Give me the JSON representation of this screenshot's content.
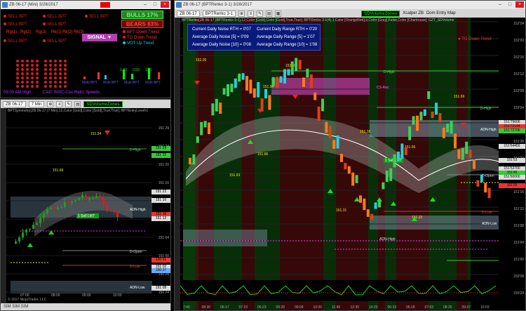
{
  "analyzer_window": {
    "title": "ZB 06-17 (Mini) 3/28/2017",
    "bulls": "BULLS 17%",
    "bears": "BEARS 83%",
    "signal": "SIGNAL",
    "signals_row1": [
      "SELL BPT",
      "SELL BPT",
      "SELL BPT"
    ],
    "signals_row2": [
      "SELL BPT",
      "SELL BPT"
    ],
    "signals_row3": [
      "SELL BPT",
      "SELL BPT"
    ],
    "rg_labels": [
      "Rg(1)",
      "Rg(2)",
      "Rg(3)",
      "Rk(1)",
      "Rk(2)",
      "Rk(3)"
    ],
    "trends": [
      "BPT Down Trend",
      "TG Down Trend",
      "VOT Up Trend"
    ],
    "dot_grid_colors": [
      "#ff3030",
      "#00c0ff"
    ],
    "bar_values": [
      "1.33",
      "0.52",
      "2.71"
    ],
    "bar_labels": [
      "Multi BPT",
      "Multi BPT",
      "Multi BPT",
      "Multi BPT"
    ],
    "footer_left": "09:00 AM   High",
    "footer_mid": "CAD: INSC-Cov-Retrc Speeds"
  },
  "left_chart": {
    "title": "ZB 06-17 (Mini) 3/28/2017",
    "instrument": "ZB 06-17",
    "interval": "7 Min",
    "indicator_tag": "SDVolumeZones",
    "header_text": "BPTSymmetry(ZB 06-17 (7 Min),12,Color [Gold],Color [Gold],True,True); BPTEntryLevelV2(ZB...",
    "labels": {
      "d_high": "D-High",
      "adn_high": "ADN-High",
      "d_open": "D-Open",
      "d_low": "D-Low",
      "adn_low": "ADN-Low",
      "price_a": "151.69",
      "price_b": "151.94",
      "price_c": "151.75",
      "price_d": "151.78",
      "sell_lmt": "1 Sell LMT"
    },
    "axis_ticks": [
      "151 29",
      "151 24",
      "151 20",
      "151 16",
      "151 12",
      "151 08",
      "151 04",
      "151 00",
      "150 28",
      "150 24"
    ],
    "axis_tags": [
      "151 29",
      "151 22",
      "151 22",
      "151 16",
      "151 18",
      "151 13",
      "150 31",
      "151 02",
      "150 27",
      "151 08"
    ],
    "time_ticks": [
      "07:00",
      "08:00",
      "09:00",
      "10:00"
    ],
    "copyright": "© 2017 NinjaTrader, LLC",
    "tabs": "SIM  SIM  SIM"
  },
  "right_chart": {
    "title": "ZB 06-17 (BPTRenko 3-1) 3/28/2017",
    "instrument": "ZB 06-17",
    "interval": "BPTRenko 3-1",
    "indicator_tag": "SDVolumeZones",
    "toolbar_extra": [
      "Xcalper ZB",
      "Dom Entry Map"
    ],
    "header_text": "BPTRenko(ZB 06-17 (BPTRenko 3-1),12,Color [Gold],Color [Gold],True,True); BPTRenko 3-1(4),1,Color [OrangeRed],9,Color [Gray],False,Color [Chartreuse]; GZT_SDVolume",
    "info": {
      "l1": "Current Daily Noise RTH = 0'07",
      "l2": "Average Daily Noise [5] = 0'09",
      "l3": "Average Daily Noise [10] = 0'08",
      "r1": "Current Daily Range RTH = 0'20",
      "r2": "Average Daily Range [5] = 1'07",
      "r3": "Average Daily Range [10] = 1'08"
    },
    "tg_trend": "TG Down Trend",
    "labels": {
      "d_high": "D-High",
      "d_high2": "D-High",
      "adn_high": "ADN-High",
      "d_open": "D-Open",
      "d_low": "D-Low",
      "adn_low": "ADN-Low",
      "adn_high_short": "ADN-High",
      "p1": "152.09",
      "p2": "152.06",
      "p3": "151.94",
      "p4": "151.86",
      "p5": "151.53",
      "p6": "151.88",
      "p7": "151.66",
      "p8": "151.56",
      "p9": "151.31",
      "p10": "151.23",
      "p11": "151.16",
      "p12": "151.69",
      "sell_lmt": "1 Sell LMT",
      "d_close": "D-Close",
      "cs": "CS-Rec"
    },
    "axis_ticks": [
      "152'24",
      "152'20",
      "152'16",
      "152'12",
      "152'08",
      "152'04",
      "152'00",
      "151'28",
      "151'24",
      "151'20",
      "151'16",
      "151'12",
      "151'08",
      "151'04",
      "151'00",
      "150'28",
      "150'24"
    ],
    "axis_tags": [
      "151'79606",
      "151'72144",
      "151'72706",
      "151'64456",
      "151'53",
      "151'52700",
      "151'45",
      "151'60000",
      "151'55"
    ],
    "time_ticks": [
      "7:40",
      "08:30",
      "06:17",
      "07:23",
      "06:23",
      "09:28",
      "09:04",
      "10:26",
      "11:40",
      "12:30",
      "14:20",
      "06:19",
      "06:18",
      "07:03",
      "08:26",
      "09:37",
      "10:03"
    ]
  }
}
